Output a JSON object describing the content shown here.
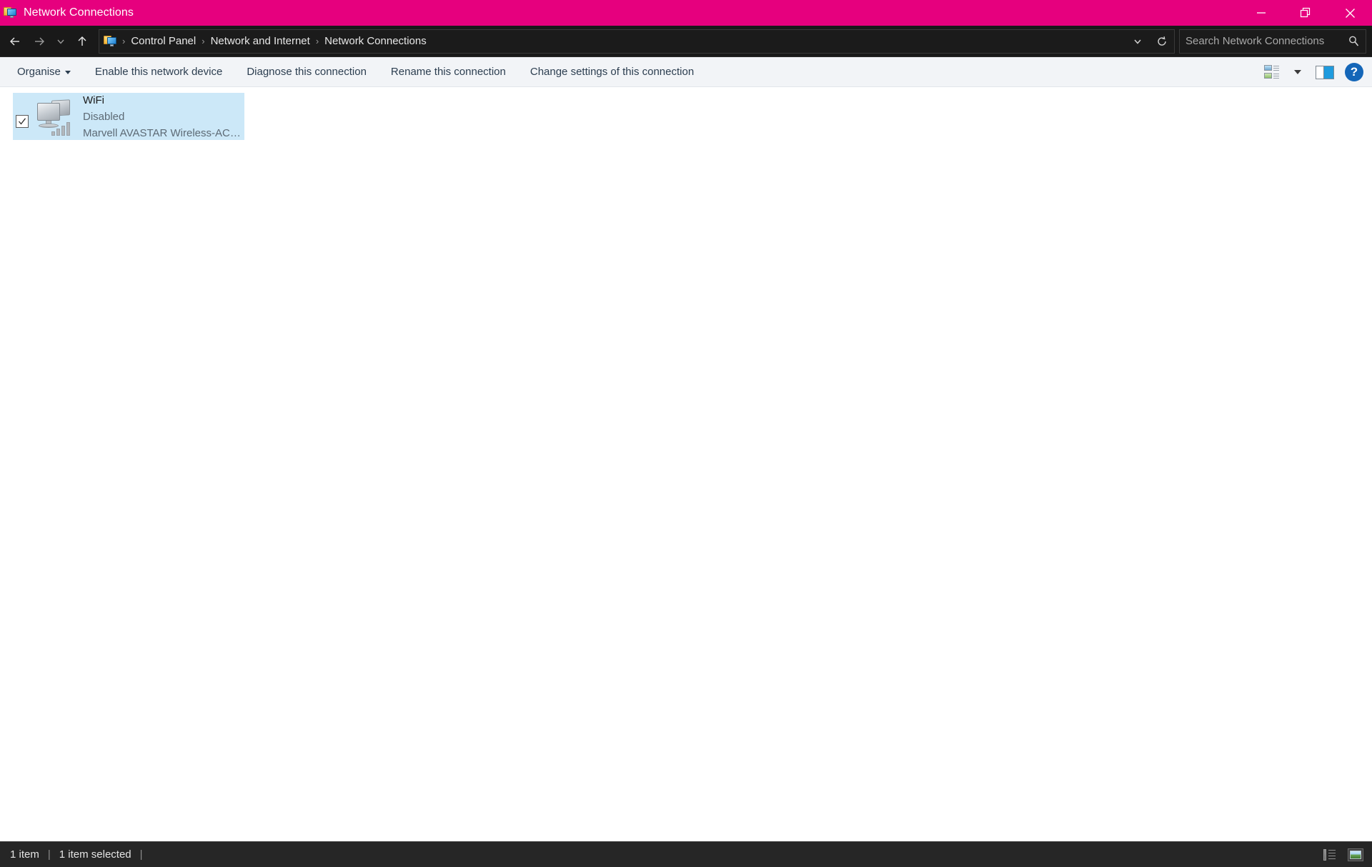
{
  "window": {
    "title": "Network Connections",
    "icon": "network-connections-icon",
    "accent_color": "#e6007e",
    "buttons": {
      "minimize": "minimize-button",
      "maximize": "restore-button",
      "close": "close-button"
    }
  },
  "navigation": {
    "back": "back-arrow",
    "forward": "forward-arrow",
    "recent": "recent-locations-chevron",
    "up": "up-arrow",
    "refresh": "refresh-icon",
    "history_dropdown": "address-dropdown-chevron",
    "breadcrumb": [
      {
        "label": "Control Panel"
      },
      {
        "label": "Network and Internet"
      },
      {
        "label": "Network Connections"
      }
    ],
    "separator": "›"
  },
  "search": {
    "placeholder": "Search Network Connections",
    "value": "",
    "icon": "search-icon"
  },
  "toolbar": {
    "items": [
      {
        "label": "Organise",
        "has_caret": true
      },
      {
        "label": "Enable this network device",
        "has_caret": false
      },
      {
        "label": "Diagnose this connection",
        "has_caret": false
      },
      {
        "label": "Rename this connection",
        "has_caret": false
      },
      {
        "label": "Change settings of this connection",
        "has_caret": false
      }
    ],
    "right_icons": {
      "view_options": "view-options-icon",
      "view_options_caret": "chevron-down-icon",
      "preview_pane": "preview-pane-icon",
      "help": "?"
    }
  },
  "connections": [
    {
      "name": "WiFi",
      "status": "Disabled",
      "device": "Marvell AVASTAR Wireless-AC ...",
      "selected": true,
      "checked": true,
      "icon": "network-adapter-disabled-icon"
    }
  ],
  "statusbar": {
    "item_count": "1 item",
    "selection": "1 item selected",
    "separator": "|",
    "views": {
      "details": "details-view-icon",
      "large_icons": "large-icons-view-icon"
    }
  }
}
